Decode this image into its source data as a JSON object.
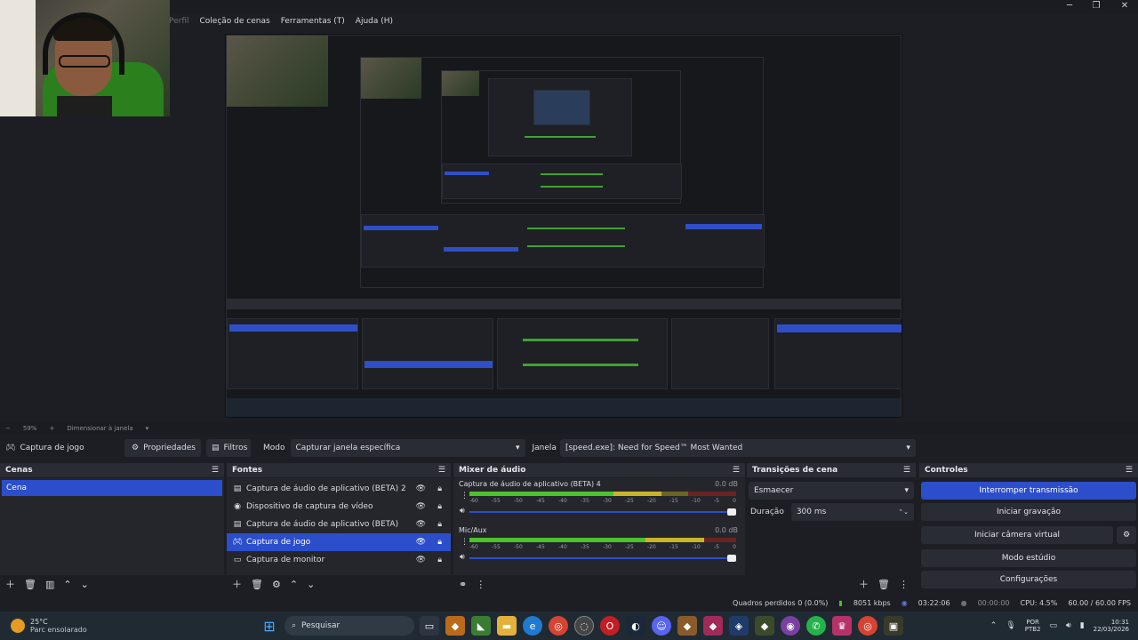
{
  "window": {
    "menu": [
      "Perfil",
      "Coleção de cenas",
      "Ferramentas (T)",
      "Ajuda (H)"
    ],
    "controls": [
      "─",
      "❐",
      "✕"
    ]
  },
  "preview": {
    "zoom": "59%",
    "resize_label": "Dimensionar à janela"
  },
  "source_toolbar": {
    "source_name": "Captura de jogo",
    "properties": "Propriedades",
    "filters": "Filtros",
    "mode_label": "Modo",
    "mode_value": "Capturar janela específica",
    "window_label": "Janela",
    "window_value": "[speed.exe]: Need for Speed™ Most Wanted"
  },
  "scenes": {
    "title": "Cenas",
    "items": [
      "Cena"
    ]
  },
  "sources": {
    "title": "Fontes",
    "items": [
      {
        "label": "Captura de áudio de aplicativo (BETA) 2",
        "icon": "list-icon"
      },
      {
        "label": "Dispositivo de captura de vídeo",
        "icon": "camera-icon"
      },
      {
        "label": "Captura de áudio de aplicativo (BETA)",
        "icon": "list-icon"
      },
      {
        "label": "Captura de jogo",
        "icon": "gamepad-icon"
      },
      {
        "label": "Captura de monitor",
        "icon": "monitor-icon"
      }
    ]
  },
  "mixer": {
    "title": "Mixer de áudio",
    "ticks": [
      "-60",
      "-55",
      "-50",
      "-45",
      "-40",
      "-35",
      "-30",
      "-25",
      "-20",
      "-15",
      "-10",
      "-5",
      "0"
    ],
    "channels": [
      {
        "name": "Captura de áudio de aplicativo (BETA) 4",
        "db": "0.0 dB",
        "level": 0.72
      },
      {
        "name": "Mic/Aux",
        "db": "0.0 dB",
        "level": 0.88
      }
    ]
  },
  "transitions": {
    "title": "Transições de cena",
    "type": "Esmaecer",
    "duration_label": "Duração",
    "duration_value": "300 ms"
  },
  "controls": {
    "title": "Controles",
    "buttons": [
      "Interromper transmissão",
      "Iniciar gravação",
      "Iniciar câmera virtual",
      "Modo estúdio",
      "Configurações"
    ]
  },
  "status": {
    "dropped": "Quadros perdidos 0 (0.0%)",
    "bitrate": "8051 kbps",
    "stream_time": "03:22:06",
    "rec_time": "00:00:00",
    "cpu": "CPU: 4.5%",
    "fps": "60.00 / 60.00 FPS"
  },
  "taskbar": {
    "weather_temp": "25°C",
    "weather_desc": "Parc ensolarado",
    "search": "Pesquisar",
    "lang1": "POR",
    "lang2": "PTB2",
    "time": "10:31",
    "date": "22/03/2026"
  },
  "colors": {
    "accent": "#2c4ecb",
    "panel": "#25262c",
    "background": "#1d1e23"
  }
}
